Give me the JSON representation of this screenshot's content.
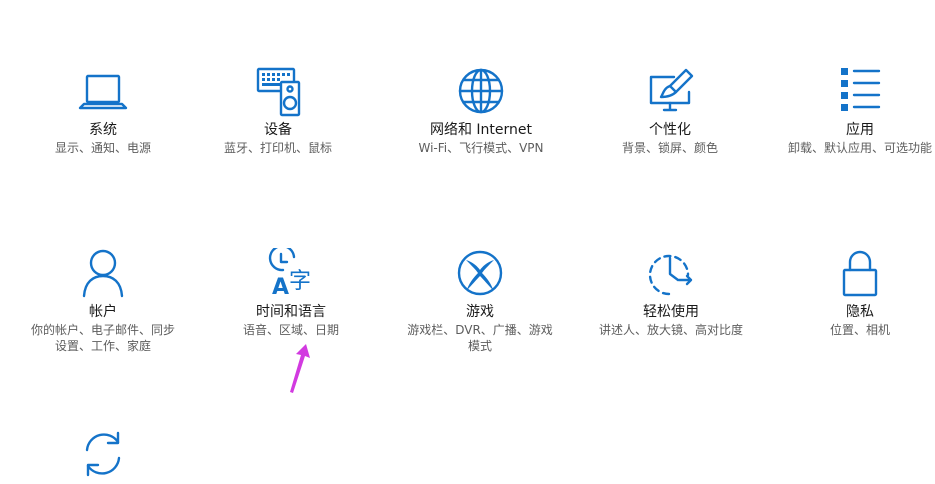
{
  "colors": {
    "accent": "#1473c9",
    "arrow": "#d23ae0"
  },
  "tiles": [
    {
      "title": "系统",
      "desc": "显示、通知、电源",
      "icon": "laptop-icon"
    },
    {
      "title": "设备",
      "desc": "蓝牙、打印机、鼠标",
      "icon": "keyboard-speaker-icon"
    },
    {
      "title": "网络和 Internet",
      "desc": "Wi-Fi、飞行模式、VPN",
      "icon": "globe-icon"
    },
    {
      "title": "个性化",
      "desc": "背景、锁屏、颜色",
      "icon": "paint-monitor-icon"
    },
    {
      "title": "应用",
      "desc": "卸载、默认应用、可选功能",
      "icon": "app-list-icon"
    },
    {
      "title": "帐户",
      "desc": "你的帐户、电子邮件、同步\n设置、工作、家庭",
      "icon": "person-icon"
    },
    {
      "title": "时间和语言",
      "desc": "语音、区域、日期",
      "icon": "time-language-icon"
    },
    {
      "title": "游戏",
      "desc": "游戏栏、DVR、广播、游戏\n模式",
      "icon": "xbox-icon"
    },
    {
      "title": "轻松使用",
      "desc": "讲述人、放大镜、高对比度",
      "icon": "ease-of-access-icon"
    },
    {
      "title": "隐私",
      "desc": "位置、相机",
      "icon": "lock-icon"
    },
    {
      "title": "",
      "desc": "",
      "icon": "update-icon"
    }
  ]
}
